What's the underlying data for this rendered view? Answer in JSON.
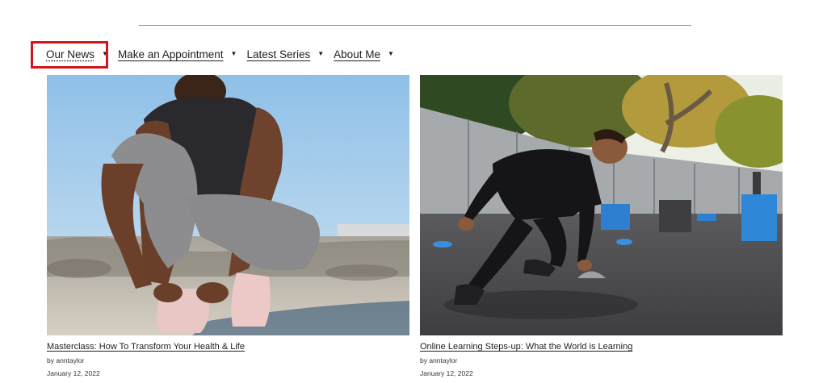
{
  "nav": {
    "items": [
      {
        "label": "Our News"
      },
      {
        "label": "Make an Appointment"
      },
      {
        "label": "Latest Series"
      },
      {
        "label": "About Me"
      }
    ],
    "caret_icon": "triangle-down-icon"
  },
  "highlight_color": "#d0161b",
  "posts": [
    {
      "title": "Masterclass: How To Transform Your Health & Life",
      "author": "by anntaylor",
      "date": "January 12, 2022",
      "image_subject": "athlete-tying-shoe-on-beach"
    },
    {
      "title": "Online Learning Steps-up: What the World is Learning",
      "author": "by anntaylor",
      "date": "January 12, 2022",
      "image_subject": "athlete-agility-training-outdoors"
    }
  ]
}
